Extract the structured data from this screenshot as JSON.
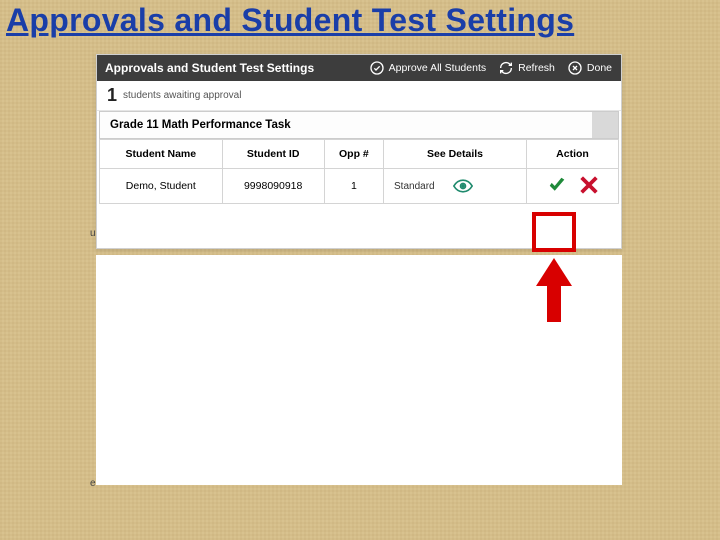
{
  "slide": {
    "title": "Approvals and Student Test Settings"
  },
  "panel": {
    "header_title": "Approvals and Student Test Settings",
    "approve_all_label": "Approve All Students",
    "refresh_label": "Refresh",
    "done_label": "Done"
  },
  "count": {
    "value": "1",
    "label": "students awaiting approval"
  },
  "subheader": "Grade 11 Math Performance Task",
  "columns": {
    "name": "Student Name",
    "id": "Student ID",
    "opp": "Opp #",
    "details": "See Details",
    "action": "Action"
  },
  "rows": [
    {
      "name": "Demo, Student",
      "id": "9998090918",
      "opp": "1",
      "details_text": "Standard"
    }
  ],
  "stray": {
    "u": "u",
    "e": "e"
  }
}
